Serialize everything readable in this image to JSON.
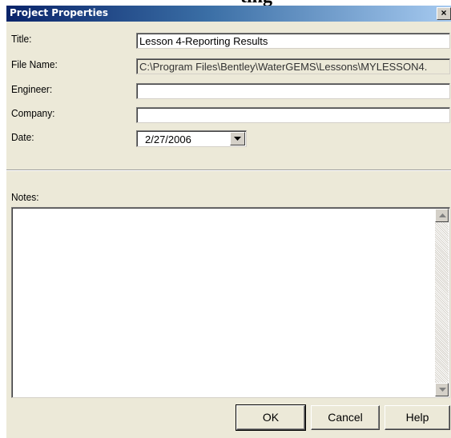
{
  "background_text": "ting",
  "dialog": {
    "title": "Project Properties",
    "close_glyph": "×"
  },
  "fields": {
    "title_label": "Title:",
    "title_value": "Lesson 4-Reporting Results",
    "filename_label": "File Name:",
    "filename_value": "C:\\Program Files\\Bentley\\WaterGEMS\\Lessons\\MYLESSON4.",
    "engineer_label": "Engineer:",
    "engineer_value": "",
    "company_label": "Company:",
    "company_value": "",
    "date_label": "Date:",
    "date_value": "2/27/2006"
  },
  "notes": {
    "label": "Notes:",
    "value": ""
  },
  "buttons": {
    "ok": "OK",
    "cancel": "Cancel",
    "help": "Help"
  },
  "colors": {
    "dialog_bg": "#ece9d8",
    "titlebar_start": "#0a246a",
    "titlebar_end": "#a6caf0"
  }
}
